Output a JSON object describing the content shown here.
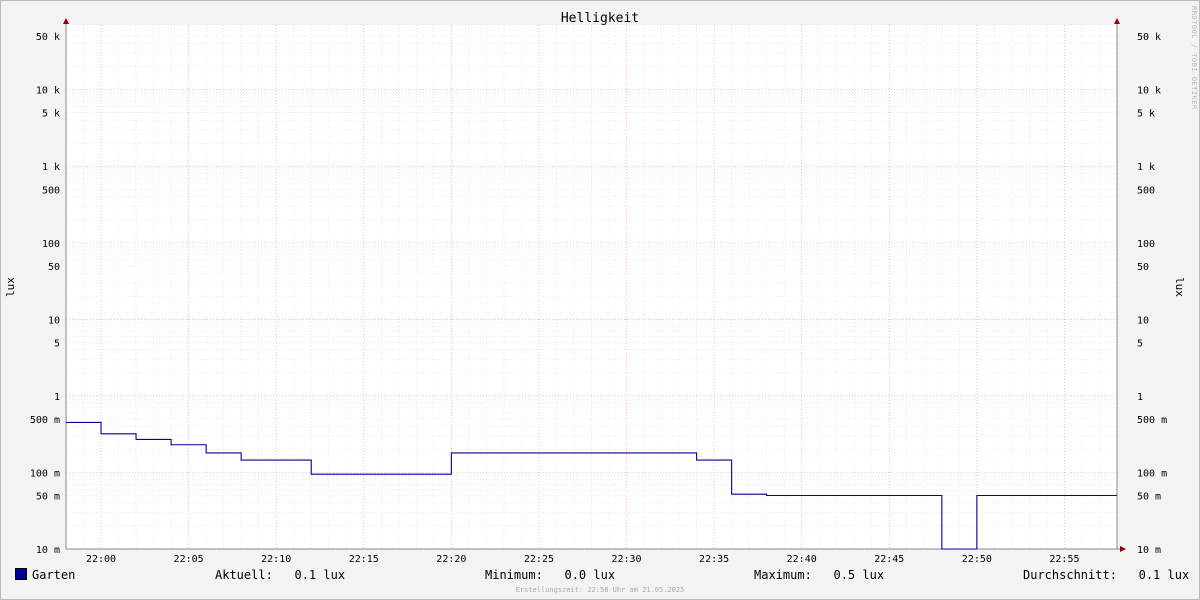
{
  "chart_data": {
    "type": "line",
    "title": "Helligkeit",
    "ylabel": "lux",
    "yscale": "log",
    "ylim": [
      0.01,
      70000
    ],
    "xlim": [
      "21:58",
      "22:58"
    ],
    "grid": true,
    "y_ticks": [
      "50 k",
      "10 k",
      "5 k",
      "1 k",
      "500",
      "100",
      "50",
      "10",
      "5",
      "1",
      "500 m",
      "100 m",
      "50 m",
      "10 m"
    ],
    "x_ticks": [
      "22:00",
      "22:05",
      "22:10",
      "22:15",
      "22:20",
      "22:25",
      "22:30",
      "22:35",
      "22:40",
      "22:45",
      "22:50",
      "22:55"
    ],
    "series": [
      {
        "name": "Garten",
        "color": "#000099",
        "step": true,
        "x": [
          "21:58",
          "22:00",
          "22:02",
          "22:04",
          "22:06",
          "22:08",
          "22:12",
          "22:20",
          "22:34",
          "22:36",
          "22:38",
          "22:48",
          "22:50",
          "22:58"
        ],
        "y": [
          0.45,
          0.32,
          0.27,
          0.23,
          0.18,
          0.145,
          0.095,
          0.18,
          0.145,
          0.052,
          0.05,
          0.01,
          0.05,
          0.05
        ]
      }
    ]
  },
  "legend": {
    "series_name": "Garten",
    "aktuell_label": "Aktuell:",
    "aktuell_value": "0.1 lux",
    "minimum_label": "Minimum:",
    "minimum_value": "0.0 lux",
    "maximum_label": "Maximum:",
    "maximum_value": "0.5 lux",
    "durchschnitt_label": "Durchschnitt:",
    "durchschnitt_value": "0.1 lux"
  },
  "footer_text": "Erstellungszeit: 22:58 Uhr am 21.05.2025",
  "watermark_text": "RRDTOOL / TOBI OETIKER"
}
